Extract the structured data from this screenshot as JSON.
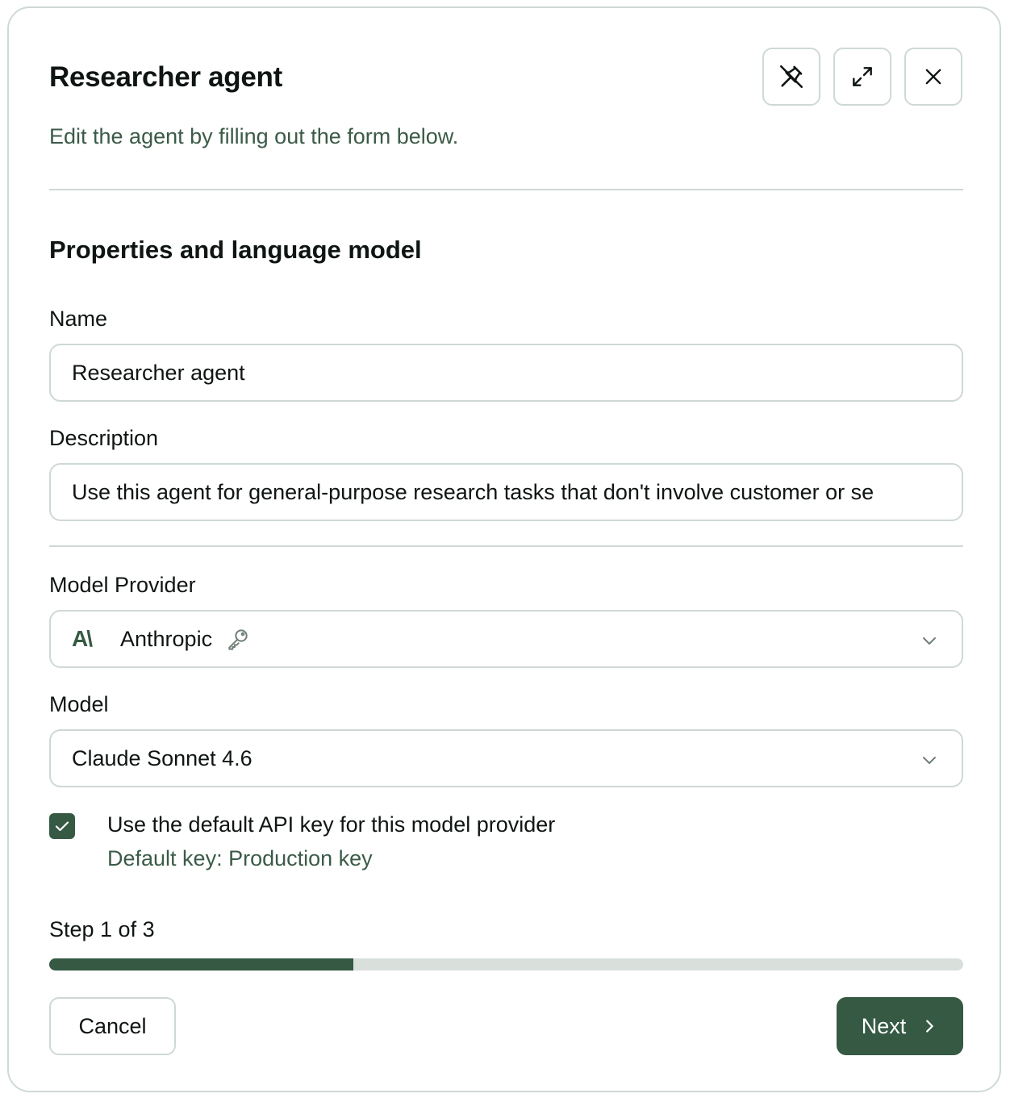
{
  "dialog": {
    "title": "Researcher agent",
    "subtitle": "Edit the agent by filling out the form below.",
    "header_icons": [
      "unpin-icon",
      "expand-icon",
      "close-icon"
    ]
  },
  "section": {
    "title": "Properties and language model"
  },
  "name_field": {
    "label": "Name",
    "value": "Researcher agent"
  },
  "description_field": {
    "label": "Description",
    "value": "Use this agent for general-purpose research tasks that don't involve customer or se"
  },
  "model_provider": {
    "label": "Model Provider",
    "logo_text": "A\\",
    "value": "Anthropic",
    "icon": "key-icon"
  },
  "model": {
    "label": "Model",
    "value": "Claude Sonnet 4.6"
  },
  "default_key": {
    "checked": true,
    "label": "Use the default API key for this model provider",
    "sub": "Default key: Production key"
  },
  "progress": {
    "label": "Step 1 of 3",
    "fraction": 0.333
  },
  "footer": {
    "cancel_label": "Cancel",
    "next_label": "Next"
  },
  "colors": {
    "accent": "#355943",
    "border": "#cfd9d4",
    "secondary_text": "#3b5b48",
    "track": "#d9dfdb"
  }
}
